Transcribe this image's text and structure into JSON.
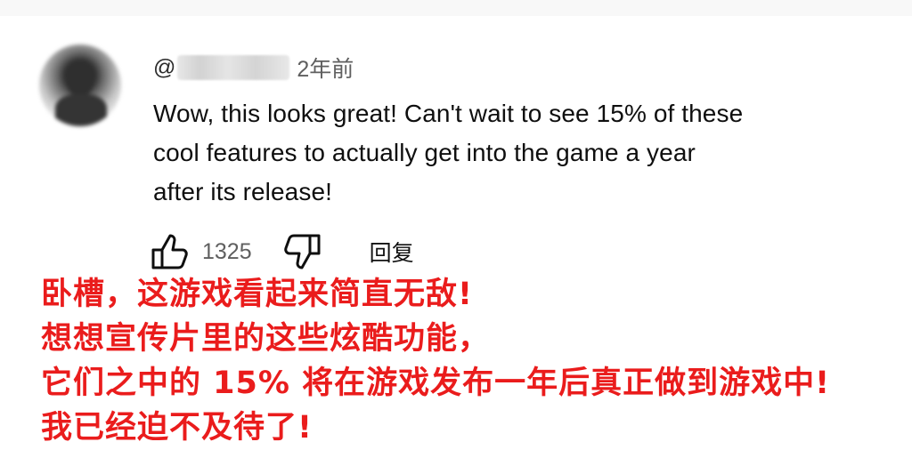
{
  "comment": {
    "handle_prefix": "@",
    "time_label": "2年前",
    "text_lines": [
      "Wow, this looks great! Can't wait to see 15% of these",
      "cool features to actually get into the game a year",
      "after its release!"
    ]
  },
  "actions": {
    "like_icon": "thumb-up-icon",
    "like_count": "1325",
    "dislike_icon": "thumb-down-icon",
    "reply_label": "回复"
  },
  "overlay": {
    "lines": [
      "卧槽，这游戏看起来简直无敌!",
      "想想宣传片里的这些炫酷功能，",
      "它们之中的 15% 将在游戏发布一年后真正做到游戏中!",
      "我已经迫不及待了!"
    ],
    "color": "#ea1c1c"
  }
}
